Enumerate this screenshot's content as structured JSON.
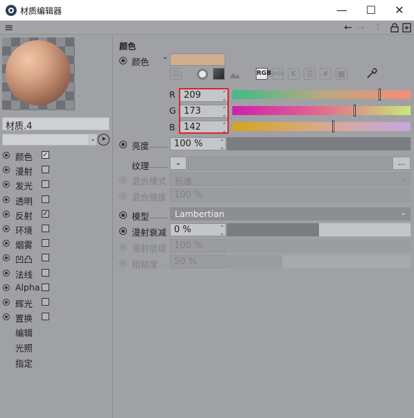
{
  "window": {
    "title": "材质编辑器",
    "controls": {
      "minimize": "—",
      "maximize": "☐",
      "close": "✕"
    }
  },
  "toolbar": {
    "menu_icon": "≡",
    "back_icon": "←",
    "forward_icon": "→",
    "up_icon": "↑",
    "lock_icon": "lock",
    "new_icon": "new-panel"
  },
  "material": {
    "name": "材质.4",
    "channels": [
      {
        "label": "颜色",
        "checked": true,
        "active": true
      },
      {
        "label": "漫射",
        "checked": false
      },
      {
        "label": "发光",
        "checked": false
      },
      {
        "label": "透明",
        "checked": false
      },
      {
        "label": "反射",
        "checked": true
      },
      {
        "label": "环境",
        "checked": false
      },
      {
        "label": "烟雾",
        "checked": false
      },
      {
        "label": "凹凸",
        "checked": false
      },
      {
        "label": "法线",
        "checked": false
      },
      {
        "label": "Alpha",
        "checked": false
      },
      {
        "label": "辉光",
        "checked": false
      },
      {
        "label": "置换",
        "checked": false
      }
    ],
    "extra_items": [
      "编辑",
      "光照",
      "指定"
    ]
  },
  "color_section": {
    "title": "颜色",
    "color_label": "颜色",
    "swatch_color": "#d1ad8e",
    "mode_icons": [
      "spectrum-icon",
      "color-wheel-icon",
      "gradient-icon",
      "image-icon",
      "RGB",
      "HSV",
      "K",
      "mixer-icon",
      "#",
      "table-icon",
      "eyedropper-icon"
    ],
    "selected_mode": "RGB",
    "r": {
      "label": "R",
      "value": "209"
    },
    "g": {
      "label": "G",
      "value": "173"
    },
    "b": {
      "label": "B",
      "value": "142"
    },
    "r_fraction": 0.82,
    "g_fraction": 0.68,
    "b_fraction": 0.56
  },
  "brightness": {
    "label": "亮度",
    "value": "100 %",
    "fraction": 1.0
  },
  "texture": {
    "label": "纹理",
    "button": "...",
    "arrow": "⌄"
  },
  "blend_mode": {
    "label": "混合模式",
    "value": "标准"
  },
  "blend_strength": {
    "label": "混合强度",
    "value": "100 %"
  },
  "model": {
    "label": "模型",
    "value": "Lambertian"
  },
  "diffuse_falloff": {
    "label": "漫射衰减",
    "value": "0 %",
    "fraction": 0.5
  },
  "diffuse_level": {
    "label": "漫射层级",
    "value": "100 %"
  },
  "roughness": {
    "label": "粗糙度",
    "value": "50 %",
    "fraction": 0.3
  },
  "colors": {
    "accent_red": "#d7262a",
    "panel_bg": "#a0a1a5"
  }
}
